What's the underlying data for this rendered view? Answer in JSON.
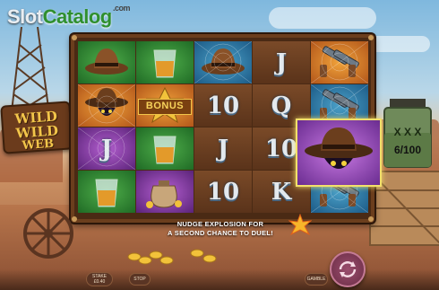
{
  "logo": {
    "part1": "Slot",
    "part2": "Catalog",
    "suffix": ".com"
  },
  "sign": {
    "line1": "WILD WILD",
    "line2": "WEB"
  },
  "reels": [
    [
      {
        "sym": "hat",
        "bg": "green"
      },
      {
        "sym": "whiskey",
        "bg": "green"
      },
      {
        "sym": "hat",
        "bg": "blue"
      },
      {
        "sym": "J",
        "bg": "wood"
      },
      {
        "sym": "revolvers",
        "bg": "orange"
      }
    ],
    [
      {
        "sym": "cowboy",
        "bg": "orange"
      },
      {
        "sym": "bonus",
        "bg": "orange"
      },
      {
        "sym": "10",
        "bg": "wood"
      },
      {
        "sym": "Q",
        "bg": "wood"
      },
      {
        "sym": "revolvers",
        "bg": "blue"
      }
    ],
    [
      {
        "sym": "J",
        "bg": "purple"
      },
      {
        "sym": "whiskey",
        "bg": "green"
      },
      {
        "sym": "J",
        "bg": "wood"
      },
      {
        "sym": "10",
        "bg": "wood"
      },
      {
        "sym": "",
        "bg": "wood"
      }
    ],
    [
      {
        "sym": "whiskey",
        "bg": "green"
      },
      {
        "sym": "moneybag",
        "bg": "purple"
      },
      {
        "sym": "10",
        "bg": "wood"
      },
      {
        "sym": "K",
        "bg": "wood"
      },
      {
        "sym": "revolvers",
        "bg": "blue"
      }
    ]
  ],
  "bonus_label": "BONUS",
  "jar": {
    "multiplier": "X X X",
    "counter": "6/100"
  },
  "message": {
    "line1": "NUDGE EXPLOSION FOR",
    "line2": "A SECOND CHANCE TO DUEL!"
  },
  "controls": {
    "stake_label": "STAKE",
    "stake_value": "£0.40",
    "stop_label": "STOP",
    "menu_label": "GAMBLE"
  },
  "icons": {
    "spin": "spin-arrows-icon",
    "nudge": "explosion-icon"
  }
}
